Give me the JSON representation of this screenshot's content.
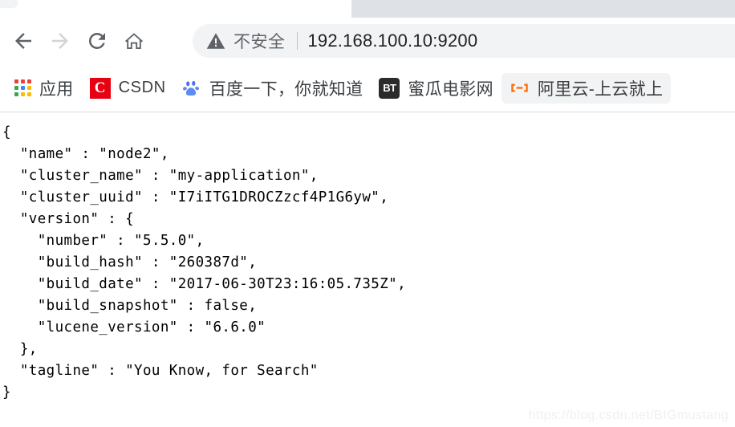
{
  "browser": {
    "tabs": [
      {
        "title": "",
        "active": true,
        "favicon_color": "#5fd9cd"
      },
      {
        "title": "",
        "active": false,
        "favicon_color": "#dee1e6"
      }
    ],
    "toolbar": {
      "back_label": "Back",
      "forward_label": "Forward",
      "reload_label": "Reload",
      "home_label": "Home",
      "security_text": "不安全",
      "url": "192.168.100.10:9200",
      "warning_icon": "warning-triangle-icon"
    },
    "bookmarks": [
      {
        "label": "应用",
        "icon": "apps-grid-icon",
        "hovered": false
      },
      {
        "label": "CSDN",
        "icon": "csdn-icon",
        "hovered": false
      },
      {
        "label": "百度一下，你就知道",
        "icon": "baidu-paw-icon",
        "hovered": false
      },
      {
        "label": "蜜瓜电影网",
        "icon": "bt-icon",
        "hovered": false
      },
      {
        "label": "阿里云-上云就上",
        "icon": "aliyun-icon",
        "hovered": true
      }
    ]
  },
  "page": {
    "json_text": "{\n  \"name\" : \"node2\",\n  \"cluster_name\" : \"my-application\",\n  \"cluster_uuid\" : \"I7iITG1DROCZzcf4P1G6yw\",\n  \"version\" : {\n    \"number\" : \"5.5.0\",\n    \"build_hash\" : \"260387d\",\n    \"build_date\" : \"2017-06-30T23:16:05.735Z\",\n    \"build_snapshot\" : false,\n    \"lucene_version\" : \"6.6.0\"\n  },\n  \"tagline\" : \"You Know, for Search\"\n}",
    "response": {
      "name": "node2",
      "cluster_name": "my-application",
      "cluster_uuid": "I7iITG1DROCZzcf4P1G6yw",
      "version": {
        "number": "5.5.0",
        "build_hash": "260387d",
        "build_date": "2017-06-30T23:16:05.735Z",
        "build_snapshot": "false",
        "lucene_version": "6.6.0"
      },
      "tagline": "You Know, for Search"
    },
    "watermark": "https://blog.csdn.net/BIGmustang"
  },
  "colors": {
    "omnibox_bg": "#f1f3f4",
    "security_text": "#5f6368",
    "url_text": "#202124",
    "inactive_tab": "#dee1e6",
    "csdn_red": "#e60012",
    "aliyun_orange": "#ff6a00",
    "baidu_blue": "#2932e1",
    "watermark": "#f0f0f0"
  }
}
